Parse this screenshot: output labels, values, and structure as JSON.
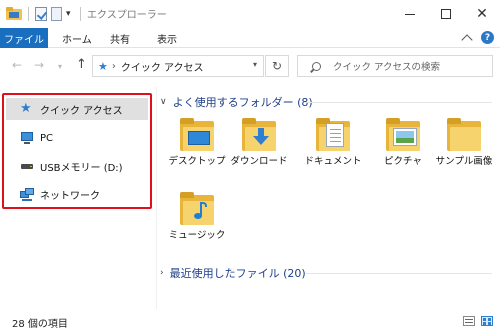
{
  "window": {
    "title": "エクスプローラー",
    "controls": {
      "minimize": "minimize",
      "maximize": "maximize",
      "close": "✕"
    }
  },
  "ribbon": {
    "tabs": [
      "ファイル",
      "ホーム",
      "共有",
      "表示"
    ],
    "active_tab_color": "#1a6ebf"
  },
  "navbar": {
    "address_label": "クイック アクセス",
    "search_placeholder": "クイック アクセスの検索"
  },
  "sidebar": {
    "items": [
      {
        "label": "クイック アクセス",
        "icon": "star-icon",
        "selected": true
      },
      {
        "label": "PC",
        "icon": "pc-icon",
        "selected": false
      },
      {
        "label": "USBメモリー (D:)",
        "icon": "usb-drive-icon",
        "selected": false
      },
      {
        "label": "ネットワーク",
        "icon": "network-icon",
        "selected": false
      }
    ],
    "highlight_color": "#e0101a"
  },
  "content": {
    "groups": [
      {
        "title": "よく使用するフォルダー (8)",
        "expanded": true
      },
      {
        "title": "最近使用したファイル (20)",
        "expanded": false
      }
    ],
    "folders": [
      {
        "label": "デスクトップ",
        "icon": "desktop-folder-icon"
      },
      {
        "label": "ダウンロード",
        "icon": "download-folder-icon"
      },
      {
        "label": "ドキュメント",
        "icon": "documents-folder-icon"
      },
      {
        "label": "ピクチャ",
        "icon": "pictures-folder-icon"
      },
      {
        "label": "サンプル画像",
        "icon": "folder-icon"
      },
      {
        "label": "ミュージック",
        "icon": "music-folder-icon"
      }
    ]
  },
  "status": {
    "item_count": "28 個の項目"
  }
}
